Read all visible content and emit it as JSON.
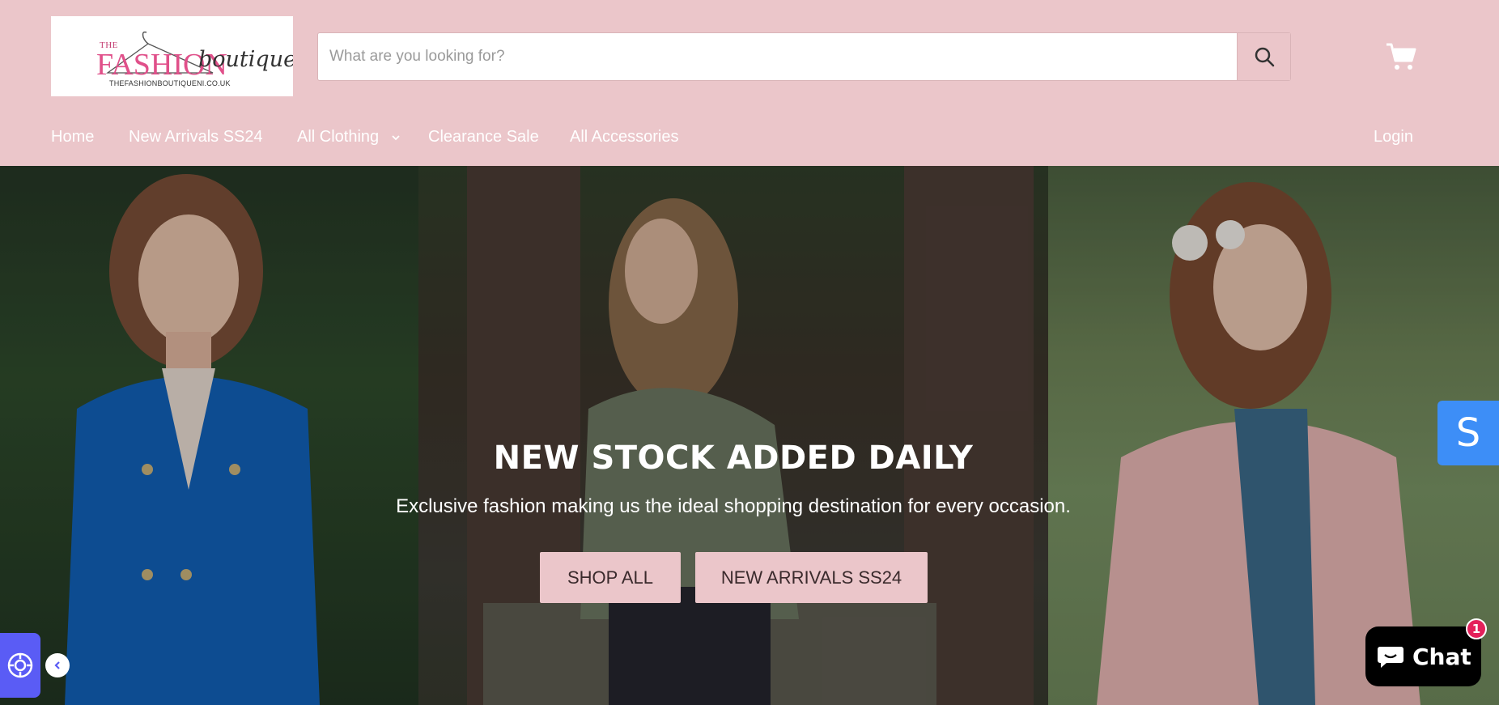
{
  "header": {
    "logo": {
      "the": "THE",
      "fashion": "FASHION",
      "boutique": "boutique",
      "domain": "THEFASHIONBOUTIQUENI.CO.UK"
    },
    "search": {
      "placeholder": "What are you looking for?"
    },
    "nav": {
      "items": [
        {
          "label": "Home"
        },
        {
          "label": "New Arrivals SS24"
        },
        {
          "label": "All Clothing"
        },
        {
          "label": "Clearance Sale"
        },
        {
          "label": "All Accessories"
        }
      ],
      "login": "Login"
    }
  },
  "hero": {
    "title": "NEW STOCK ADDED DAILY",
    "subtitle": "Exclusive fashion making us the ideal shopping destination for every occasion.",
    "buttons": {
      "shop_all": "SHOP ALL",
      "new_arrivals": "NEW ARRIVALS SS24"
    }
  },
  "widgets": {
    "side_tab": "S",
    "chat_label": "Chat",
    "chat_badge": "1"
  },
  "colors": {
    "header_bg": "#ebc6ca",
    "button_bg": "#ebc6ca",
    "side_tab": "#3d8ef7",
    "accessibility": "#5a5cf5",
    "chat_badge": "#e4205b"
  },
  "icons": [
    "hanger-logo",
    "search-icon",
    "cart-icon",
    "chevron-down-icon",
    "accessibility-icon",
    "chevron-left-icon",
    "chat-bubble-icon"
  ]
}
